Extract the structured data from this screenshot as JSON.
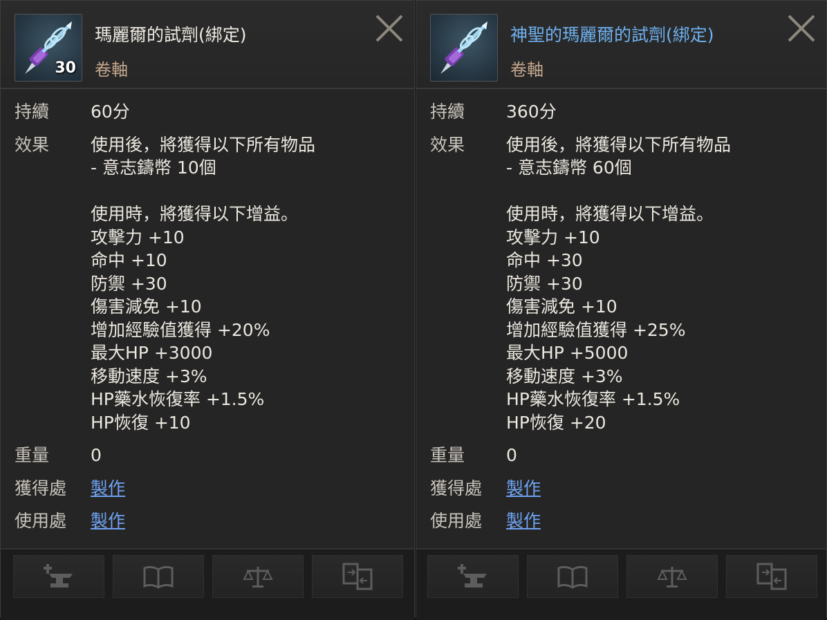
{
  "left": {
    "title": "瑪麗爾的試劑(綁定)",
    "subtitle": "卷軸",
    "quantity": "30",
    "rows": {
      "duration_label": "持續",
      "duration_value": "60分",
      "effect_label": "效果",
      "effect_value": "使用後，將獲得以下所有物品\n- 意志鑄幣 10個\n\n使用時，將獲得以下增益。\n攻擊力 +10\n命中 +10\n防禦 +30\n傷害減免 +10\n增加經驗值獲得 +20%\n最大HP +3000\n移動速度 +3%\nHP藥水恢復率 +1.5%\nHP恢復 +10",
      "weight_label": "重量",
      "weight_value": "0",
      "source_label": "獲得處",
      "source_value": "製作",
      "use_label": "使用處",
      "use_value": "製作"
    }
  },
  "right": {
    "title": "神聖的瑪麗爾的試劑(綁定)",
    "subtitle": "卷軸",
    "rows": {
      "duration_label": "持續",
      "duration_value": "360分",
      "effect_label": "效果",
      "effect_value": "使用後，將獲得以下所有物品\n- 意志鑄幣 60個\n\n使用時，將獲得以下增益。\n攻擊力 +10\n命中 +30\n防禦 +30\n傷害減免 +10\n增加經驗值獲得 +25%\n最大HP +5000\n移動速度 +3%\nHP藥水恢復率 +1.5%\nHP恢復 +20",
      "weight_label": "重量",
      "weight_value": "0",
      "source_label": "獲得處",
      "source_value": "製作",
      "use_label": "使用處",
      "use_value": "製作"
    }
  },
  "footer_icons": [
    "anvil-icon",
    "book-icon",
    "scales-icon",
    "compare-icon"
  ],
  "colors": {
    "link": "#6fa3f2",
    "title_blue": "#6fb1f0",
    "subtitle": "#c5a78d"
  }
}
